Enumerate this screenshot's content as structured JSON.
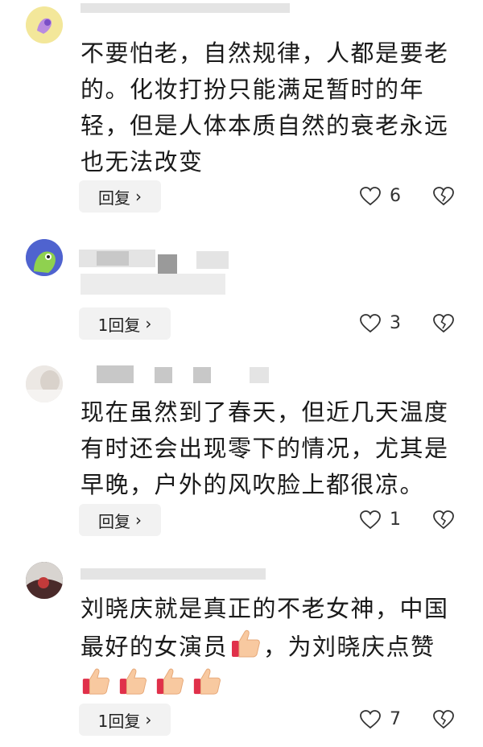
{
  "comments": [
    {
      "name": "",
      "text": "不要怕老，自然规律，人都是要老的。化妆打扮只能满足暂时的年轻，但是人体本质自然的衰老永远也无法改变",
      "reply_label": "回复",
      "likes": "6",
      "avatar_icon": "sticker-avatar-icon"
    },
    {
      "name": "",
      "text": "",
      "reply_label": "1回复",
      "likes": "3",
      "avatar_icon": "cartoon-avatar-icon"
    },
    {
      "name": "",
      "text": "现在虽然到了春天，但近几天温度有时还会出现零下的情况，尤其是早晚，户外的风吹脸上都很凉。",
      "reply_label": "回复",
      "likes": "1",
      "avatar_icon": "photo-avatar-icon"
    },
    {
      "name": "",
      "text": "刘晓庆就是真正的不老女神，中国最好的女演员",
      "text_tail": "，为刘晓庆点赞",
      "reply_label": "1回复",
      "likes": "7",
      "avatar_icon": "dark-avatar-icon",
      "emoji": "thumbs-up-emoji"
    }
  ],
  "colors": {
    "reply_bg": "#f2f2f2",
    "text": "#1a1a1a",
    "icon": "#333333"
  }
}
